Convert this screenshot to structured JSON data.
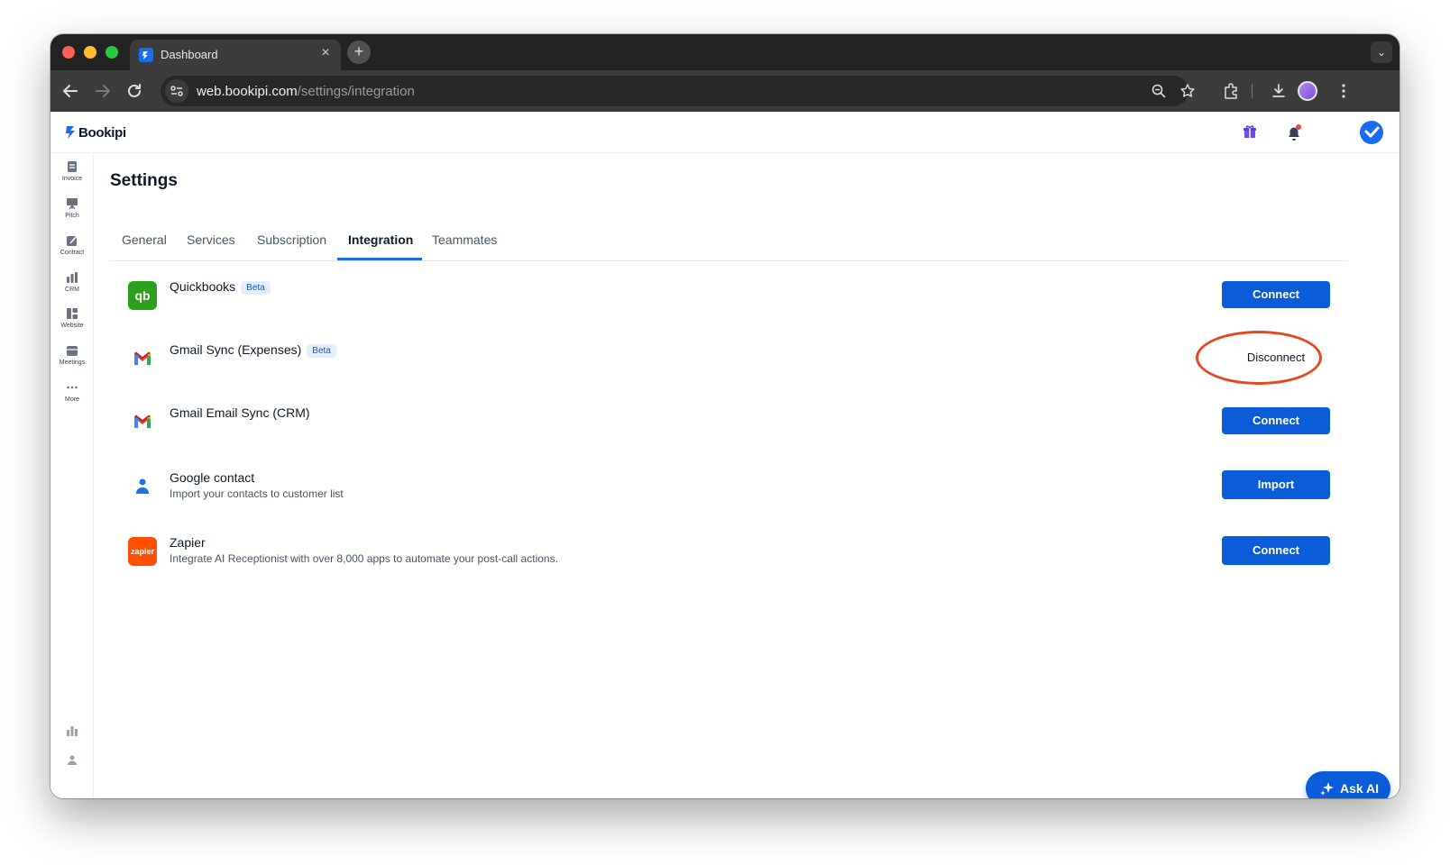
{
  "browser": {
    "tab_title": "Dashboard",
    "new_tab_label": "+",
    "url_host": "web.bookipi.com",
    "url_path": "/settings/integration"
  },
  "app": {
    "brand": "Bookipi"
  },
  "sidebar": {
    "items": [
      {
        "label": "Invoice",
        "icon": "invoice-icon"
      },
      {
        "label": "Pitch",
        "icon": "pitch-icon"
      },
      {
        "label": "Contract",
        "icon": "contract-icon"
      },
      {
        "label": "CRM",
        "icon": "crm-icon"
      },
      {
        "label": "Website",
        "icon": "website-icon"
      },
      {
        "label": "Meetings",
        "icon": "meetings-icon"
      },
      {
        "label": "More",
        "icon": "more-icon"
      }
    ]
  },
  "page": {
    "title": "Settings",
    "tabs": [
      "General",
      "Services",
      "Subscription",
      "Integration",
      "Teammates"
    ],
    "active_tab": "Integration"
  },
  "integrations": [
    {
      "name": "Quickbooks",
      "badge": "Beta",
      "description": "",
      "action": "Connect",
      "logo_color": "#2ca01c"
    },
    {
      "name": "Gmail Sync (Expenses)",
      "badge": "Beta",
      "description": "",
      "action": "Disconnect",
      "logo_color": "#ea4335"
    },
    {
      "name": "Gmail Email Sync (CRM)",
      "badge": "",
      "description": "",
      "action": "Connect",
      "logo_color": "#ea4335"
    },
    {
      "name": "Google contact",
      "badge": "",
      "description": "Import your contacts to customer list",
      "action": "Import",
      "logo_color": "#1a73e8"
    },
    {
      "name": "Zapier",
      "badge": "",
      "description": "Integrate AI Receptionist with over 8,000 apps to automate your post-call actions.",
      "action": "Connect",
      "logo_color": "#ff4f00",
      "logo_text": "zapier"
    }
  ],
  "ask_ai": {
    "label": "Ask AI"
  },
  "colors": {
    "primary": "#0b5cd9",
    "annotation": "#e8471d"
  }
}
